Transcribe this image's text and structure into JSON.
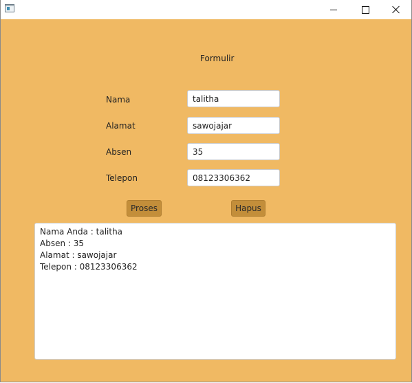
{
  "window": {
    "icon": "java-app-icon",
    "controls": {
      "minimize": "minimize-icon",
      "maximize": "maximize-icon",
      "close": "close-icon"
    },
    "background_color": "#f0b963"
  },
  "form": {
    "title": "Formulir",
    "fields": [
      {
        "label": "Nama",
        "value": "talitha"
      },
      {
        "label": "Alamat",
        "value": "sawojajar"
      },
      {
        "label": "Absen",
        "value": "35"
      },
      {
        "label": "Telepon",
        "value": "08123306362"
      }
    ],
    "buttons": {
      "proses": "Proses",
      "hapus": "Hapus"
    }
  },
  "output": {
    "lines": [
      "Nama Anda : talitha",
      "Absen : 35",
      "Alamat : sawojajar",
      "Telepon : 08123306362"
    ]
  }
}
